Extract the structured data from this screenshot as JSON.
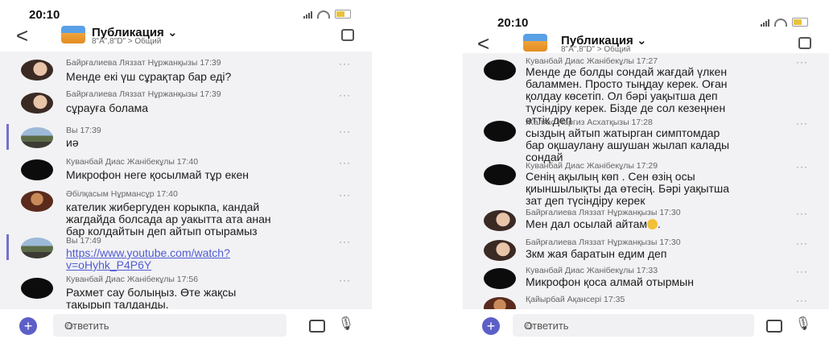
{
  "left": {
    "time": "20:10",
    "header": {
      "title": "Публикация ⌄",
      "subtitle": "8\"А\",8\"D\" > Общий"
    },
    "compose_placeholder": "Ответить",
    "messages": [
      {
        "meta": "Байрғалиева Ляззат Нұржанқызы 17:39",
        "text": "Менде екі үш сұрақтар бар еді?"
      },
      {
        "meta": "Байрғалиева Ляззат Нұржанқызы 17:39",
        "text": "сұрауға болама"
      },
      {
        "meta": "Вы 17:39",
        "text": "иә"
      },
      {
        "meta": "Куванбай Диас Жанібекұлы 17:40",
        "text": "Микрофон неге қосылмай тұр екен"
      },
      {
        "meta": "Әбілқасым Нұрмансұр 17:40",
        "text": "кателик жибергуден корыкпа, кандай\nжагдайда болсада ар уакытта ата анан\nбар колдайтын деп айтып отырамыз"
      },
      {
        "meta": "Вы 17:49",
        "link": "https://www.youtube.com/watch?\nv=oHyhk_P4P6Y"
      },
      {
        "meta": "Куванбай Диас Жанібекұлы 17:56",
        "text": "Рахмет сау болыңыз. Өте жақсы\nтақырып талданды."
      }
    ]
  },
  "right": {
    "time": "20:10",
    "header": {
      "title": "Публикация ⌄",
      "subtitle": "8\"А\",8\"D\" > Общий"
    },
    "compose_placeholder": "Ответить",
    "messages": [
      {
        "meta": "Куванбай Диас Жанібекұлы 17:27",
        "text": "Менде де болды сондай жағдай үлкен\nбаламмен. Просто тыңдау керек. Оған\nқолдау көсетіп. Ол бәрі уақытша деп\nтүсіндіру керек. Бізде де сол кезеңнен\nөттік деп"
      },
      {
        "meta": "Жалғас Наргиз Асхатқызы 17:28",
        "text": "сыздың айтып жатырган симптомдар\nбар оқшаулану ашушан жылап калады\nсондай"
      },
      {
        "meta": "Куванбай Диас Жанібекұлы 17:29",
        "text": "Сенің ақылың көп . Сен өзің осы\nқиыншылықты да өтесің. Бәрі уақытша\nзат деп түсіндіру керек"
      },
      {
        "meta": "Байрғалиева Ляззат Нұржанқызы 17:30",
        "text": "Мен дал осылай айтам"
      },
      {
        "meta": "Байрғалиева Ляззат Нұржанқызы 17:30",
        "text": "3км жая баратын едим деп"
      },
      {
        "meta": "Куванбай Диас Жанібекұлы 17:33",
        "text": "Микрофон қоса алмай отырмын"
      },
      {
        "meta": "Қайырбай Ақансері 17:35",
        "text": ""
      }
    ]
  },
  "colors": {
    "accent": "#5b5fc7",
    "link": "#4f5bd5",
    "feed_bg": "#f2f2f4"
  }
}
